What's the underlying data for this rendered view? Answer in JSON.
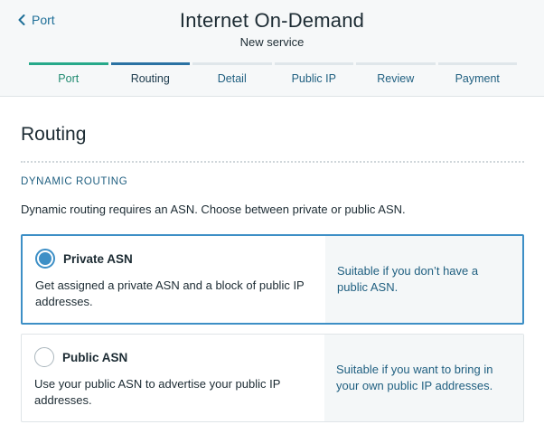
{
  "header": {
    "back_label": "Port",
    "title": "Internet On-Demand",
    "subtitle": "New service"
  },
  "steps": [
    {
      "label": "Port",
      "state": "done"
    },
    {
      "label": "Routing",
      "state": "active"
    },
    {
      "label": "Detail",
      "state": "todo"
    },
    {
      "label": "Public IP",
      "state": "todo"
    },
    {
      "label": "Review",
      "state": "todo"
    },
    {
      "label": "Payment",
      "state": "todo"
    }
  ],
  "section": {
    "title": "Routing",
    "subheading": "DYNAMIC ROUTING",
    "description": "Dynamic routing requires an ASN. Choose between private or public ASN."
  },
  "options": [
    {
      "title": "Private ASN",
      "text": "Get assigned a private ASN and a block of public IP addresses.",
      "side": "Suitable if you don’t have a public ASN.",
      "selected": true
    },
    {
      "title": "Public ASN",
      "text": "Use your public ASN to advertise your public IP addresses.",
      "side": "Suitable if you want to bring in your own public IP addresses.",
      "selected": false
    }
  ],
  "colors": {
    "accent": "#3d8fc6",
    "step_done": "#27a98a",
    "step_active": "#2a72a3"
  }
}
